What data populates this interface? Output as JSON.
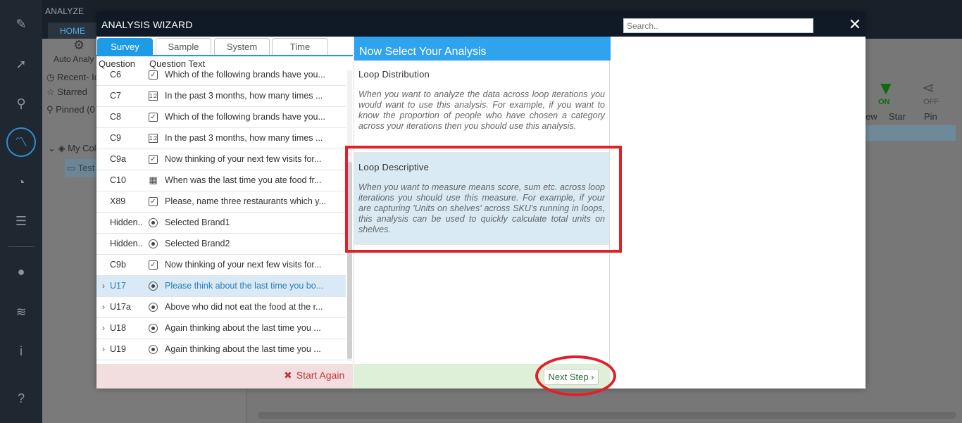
{
  "background_app": {
    "section_label": "ANALYZE",
    "home_tab": "HOME",
    "auto_analysis": "Auto Analy",
    "recent": "Recent- Ic",
    "starred": "Starred",
    "pinned": "Pinned (0",
    "my_collection": "My Coll",
    "test_item": "Test",
    "toolbar": {
      "filter_state": "ON",
      "share_state": "OFF",
      "col_view": "ew",
      "col_star": "Star",
      "col_pin": "Pin"
    }
  },
  "modal": {
    "title": "ANALYSIS WIZARD",
    "search_placeholder": "Search..",
    "close_label": "✕"
  },
  "tabs": [
    {
      "label": "Survey",
      "active": true
    },
    {
      "label": "Sample",
      "active": false
    },
    {
      "label": "System",
      "active": false
    },
    {
      "label": "Time",
      "active": false
    }
  ],
  "question_list": {
    "col_question": "Question",
    "col_text": "Question Text",
    "rows": [
      {
        "code": "C6",
        "type": "checkbox",
        "text": "Which of the following brands have you...",
        "expandable": false,
        "selected": false
      },
      {
        "code": "C7",
        "type": "numeric",
        "text": "In the past 3 months, how many times ...",
        "expandable": false,
        "selected": false
      },
      {
        "code": "C8",
        "type": "checkbox",
        "text": "Which of the following brands have you...",
        "expandable": false,
        "selected": false
      },
      {
        "code": "C9",
        "type": "numeric",
        "text": "In the past 3 months, how many times ...",
        "expandable": false,
        "selected": false
      },
      {
        "code": "C9a",
        "type": "checkbox",
        "text": "Now thinking of your next few visits for...",
        "expandable": false,
        "selected": false
      },
      {
        "code": "C10",
        "type": "grid",
        "text": "When was the last time you ate food fr...",
        "expandable": false,
        "selected": false
      },
      {
        "code": "X89",
        "type": "checkbox",
        "text": "Please, name three restaurants which y...",
        "expandable": false,
        "selected": false
      },
      {
        "code": "Hidden..",
        "type": "radio",
        "text": "Selected Brand1",
        "expandable": false,
        "selected": false
      },
      {
        "code": "Hidden..",
        "type": "radio",
        "text": "Selected Brand2",
        "expandable": false,
        "selected": false
      },
      {
        "code": "C9b",
        "type": "checkbox",
        "text": "Now thinking of your next few visits for...",
        "expandable": false,
        "selected": false
      },
      {
        "code": "U17",
        "type": "radio",
        "text": "Please think about the last time you bo...",
        "expandable": true,
        "selected": true
      },
      {
        "code": "U17a",
        "type": "radio",
        "text": "Above who did not eat the food at the r...",
        "expandable": true,
        "selected": false
      },
      {
        "code": "U18",
        "type": "radio",
        "text": "Again thinking about the last time you ...",
        "expandable": true,
        "selected": false
      },
      {
        "code": "U19",
        "type": "radio",
        "text": "Again thinking about the last time you ...",
        "expandable": true,
        "selected": false
      }
    ]
  },
  "start_again": "Start Again",
  "analysis": {
    "header": "Now Select Your Analysis",
    "items": [
      {
        "name": "Loop Distribution",
        "description": "When you want to analyze the data across loop iterations you would want to use this analysis. For example, if you want to know the proportion of people who have chosen a category across your iterations then you should use this analysis.",
        "selected": false
      },
      {
        "name": "Loop Descriptive",
        "description": "When you want to measure means score, sum etc. across loop iterations you should use this measure. For example, if your are capturing 'Units on shelves' across SKU's running in loops, this analysis can be used to quickly calculate total units on shelves.",
        "selected": true
      }
    ],
    "next_step": "Next Step ›"
  },
  "colors": {
    "accent_blue": "#1e9be7",
    "header_dark": "#0f1a26",
    "annotation_red": "#e0212a",
    "footer_green": "#dff0d8",
    "footer_pink": "#f2dede"
  }
}
